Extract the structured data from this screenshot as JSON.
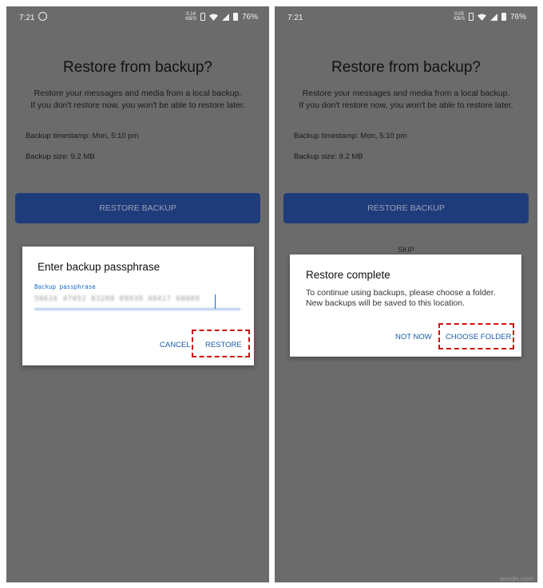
{
  "screens": [
    {
      "status": {
        "time": "7:21",
        "net_speed": "0.14",
        "net_unit": "KB/S",
        "battery": "76%"
      },
      "title": "Restore from backup?",
      "description_line1": "Restore your messages and media from a local backup.",
      "description_line2": "If you don't restore now, you won't be able to restore later.",
      "backup_timestamp": "Backup timestamp: Mon, 5:10 pm",
      "backup_size": "Backup size: 9.2 MB",
      "restore_button": "RESTORE BACKUP",
      "dialog": {
        "title": "Enter backup passphrase",
        "field_label": "Backup passphrase",
        "field_value": "50616 47052 83208 09939 48417 60809",
        "cancel": "CANCEL",
        "confirm": "RESTORE"
      }
    },
    {
      "status": {
        "time": "7:21",
        "net_speed": "0.05",
        "net_unit": "KB/S",
        "battery": "76%"
      },
      "title": "Restore from backup?",
      "description_line1": "Restore your messages and media from a local backup.",
      "description_line2": "If you don't restore now, you won't be able to restore later.",
      "backup_timestamp": "Backup timestamp: Mon, 5:10 pm",
      "backup_size": "Backup size: 9.2 MB",
      "restore_button": "RESTORE BACKUP",
      "skip": "SKIP",
      "dialog": {
        "title": "Restore complete",
        "message": "To continue using backups, please choose a folder. New backups will be saved to this location.",
        "not_now": "NOT NOW",
        "choose_folder": "CHOOSE FOLDER"
      }
    }
  ],
  "watermark": "wsxdn.com",
  "colors": {
    "primary_button": "#1f3c7a",
    "accent": "#1c6ac9",
    "highlight": "#d01010",
    "scrim": "#6b6b6b"
  }
}
